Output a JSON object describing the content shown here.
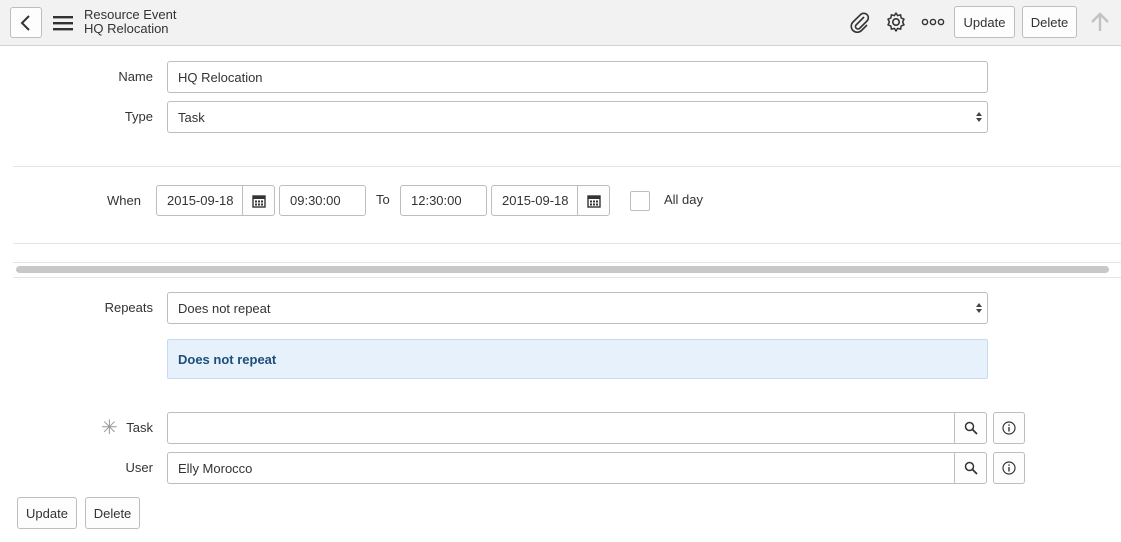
{
  "header": {
    "table_label": "Resource Event",
    "record_title": "HQ Relocation",
    "update_label": "Update",
    "delete_label": "Delete"
  },
  "form": {
    "name_label": "Name",
    "name_value": "HQ Relocation",
    "type_label": "Type",
    "type_value": "Task",
    "when_label": "When",
    "start_date": "2015-09-18",
    "start_time": "09:30:00",
    "to_label": "To",
    "end_time": "12:30:00",
    "end_date": "2015-09-18",
    "all_day_label": "All day",
    "all_day_checked": false,
    "repeats_label": "Repeats",
    "repeats_value": "Does not repeat",
    "repeat_summary": "Does not repeat",
    "task_label": "Task",
    "task_value": "",
    "user_label": "User",
    "user_value": "Elly Morocco"
  },
  "footer": {
    "update_label": "Update",
    "delete_label": "Delete"
  }
}
